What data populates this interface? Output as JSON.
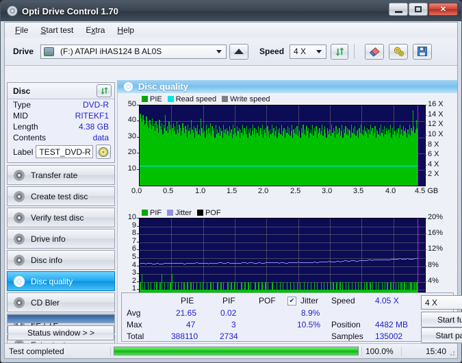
{
  "window": {
    "title": "Opti Drive Control 1.70",
    "icon": "disc-icon",
    "controls": {
      "minimize": "minimize-icon",
      "maximize": "maximize-icon",
      "close": "✕"
    }
  },
  "menu": [
    {
      "label": "File",
      "accel": "F"
    },
    {
      "label": "Start test",
      "accel": "S"
    },
    {
      "label": "Extra",
      "accel": "x"
    },
    {
      "label": "Help",
      "accel": "H"
    }
  ],
  "toolbar": {
    "drive_label": "Drive",
    "drive_value": "(F:)  ATAPI iHAS124   B AL0S",
    "eject_icon": "eject-icon",
    "speed_label": "Speed",
    "speed_value": "4 X",
    "refresh_icon": "refresh-icon",
    "erase_icon": "eraser-icon",
    "settings_icon": "gear-icon",
    "save_icon": "save-icon"
  },
  "disc": {
    "title": "Disc",
    "refresh_icon": "refresh-icon",
    "rows": [
      {
        "key": "Type",
        "value": "DVD-R"
      },
      {
        "key": "MID",
        "value": "RITEKF1"
      },
      {
        "key": "Length",
        "value": "4.38 GB"
      },
      {
        "key": "Contents",
        "value": "data"
      }
    ],
    "label_key": "Label",
    "label_value": "TEST_DVD-R",
    "label_placeholder": "",
    "disc_icon": "cd-icon"
  },
  "sidebar": {
    "items": [
      {
        "label": "Transfer rate",
        "icon": "disc-icon",
        "active": false
      },
      {
        "label": "Create test disc",
        "icon": "disc-icon",
        "active": false
      },
      {
        "label": "Verify test disc",
        "icon": "disc-icon",
        "active": false
      },
      {
        "label": "Drive info",
        "icon": "drive-icon",
        "active": false
      },
      {
        "label": "Disc info",
        "icon": "disc-icon",
        "active": false
      },
      {
        "label": "Disc quality",
        "icon": "disc-icon",
        "active": true
      },
      {
        "label": "CD Bler",
        "icon": "disc-icon",
        "active": false
      },
      {
        "label": "FE / TE",
        "icon": "disc-icon",
        "active": false
      },
      {
        "label": "Extra tests",
        "icon": "disc-icon",
        "active": false
      }
    ],
    "status_window_button": "Status window > >"
  },
  "panel": {
    "title": "Disc quality",
    "icon": "disc-icon"
  },
  "stats": {
    "col_headers": [
      "PIE",
      "PIF",
      "POF",
      "Jitter"
    ],
    "row_headers": [
      "Avg",
      "Max",
      "Total"
    ],
    "pie": {
      "avg": "21.65",
      "max": "47",
      "total": "388110"
    },
    "pif": {
      "avg": "0.02",
      "max": "3",
      "total": "2734"
    },
    "pof": {
      "avg": "",
      "max": "",
      "total": ""
    },
    "jitter": {
      "avg": "8.9%",
      "max": "10.5%",
      "total": ""
    },
    "jitter_checked": "✔",
    "speed_key": "Speed",
    "speed_value": "4.05 X",
    "position_key": "Position",
    "position_value": "4482 MB",
    "samples_key": "Samples",
    "samples_value": "135002",
    "speed_select": "4 X",
    "start_full": "Start full",
    "start_part": "Start part"
  },
  "statusbar": {
    "message": "Test completed",
    "progress_pct": "100.0%",
    "progress_value": 100,
    "time": "15:40"
  },
  "colors": {
    "pie": "#00c000",
    "read_speed": "#00e5e5",
    "write_speed": "#808080",
    "pif": "#00c000",
    "jitter": "#8f8fe8",
    "pof": "#000000",
    "plot_bg": "#0b0b56",
    "accent": "#2222cc"
  },
  "chart_data": [
    {
      "type": "bar",
      "title": "PIE",
      "xlabel": "GB",
      "ylabel": "PIE",
      "y2label": "X",
      "xlim": [
        0.0,
        4.5
      ],
      "ylim": [
        0,
        50
      ],
      "y2lim": [
        0,
        16
      ],
      "xticks": [
        "0.0",
        "0.5",
        "1.0",
        "1.5",
        "2.0",
        "2.5",
        "3.0",
        "3.5",
        "4.0",
        "4.5 GB"
      ],
      "yticks": [
        "10",
        "20",
        "30",
        "40",
        "50"
      ],
      "y2ticks": [
        "2 X",
        "4 X",
        "6 X",
        "8 X",
        "10 X",
        "12 X",
        "14 X",
        "16 X"
      ],
      "grid": true,
      "legend": [
        "PIE",
        "Read speed",
        "Write speed"
      ],
      "legend_position": "top-left",
      "data_end_x": 4.38,
      "series": [
        {
          "name": "PIE",
          "color": "#00c000",
          "values": [
            45,
            42,
            40,
            44,
            41,
            38,
            39,
            43,
            37,
            40,
            36,
            41,
            38,
            35,
            42,
            37,
            39,
            34,
            40,
            36,
            38,
            33,
            41,
            37,
            35,
            39,
            32,
            38,
            36,
            44,
            34,
            37,
            33,
            40,
            35,
            38,
            31,
            36,
            39,
            34,
            37,
            32,
            40,
            35,
            33,
            38,
            36,
            31,
            34,
            39,
            36,
            33,
            37,
            35,
            30,
            38,
            34,
            36,
            32,
            41,
            35,
            33,
            37,
            30,
            36,
            34,
            38,
            32,
            35,
            31,
            42,
            36,
            33,
            37,
            34,
            30,
            38,
            35,
            32,
            36,
            33,
            39,
            31,
            37,
            34,
            36,
            30,
            38,
            32,
            35,
            33,
            37,
            31,
            36,
            34,
            30,
            38,
            33,
            35,
            32,
            36,
            34,
            31,
            37,
            33,
            35,
            30,
            38,
            32,
            36,
            33,
            31,
            37,
            34,
            36,
            30,
            35,
            33,
            38,
            31,
            36,
            34,
            32,
            37,
            30,
            35,
            33,
            36,
            31,
            34,
            38,
            32,
            36,
            30,
            35,
            33,
            37,
            31,
            34,
            36,
            32,
            38,
            30,
            35,
            33,
            36,
            31,
            37,
            34,
            30,
            35,
            32,
            38,
            33,
            36,
            31,
            34,
            37,
            30,
            35,
            33,
            36,
            32,
            38,
            31,
            34,
            36,
            30,
            35,
            33,
            37,
            32,
            36,
            31,
            34,
            38,
            30,
            35,
            33,
            36,
            32,
            37,
            31,
            35,
            34,
            30,
            36,
            33,
            38,
            32,
            35,
            31,
            37,
            34,
            36,
            30,
            33,
            35,
            32,
            38,
            31,
            36,
            34,
            37,
            30,
            35,
            33,
            36,
            32,
            34,
            38,
            31,
            35,
            37,
            33,
            30,
            36,
            34,
            32,
            35,
            31,
            38,
            33,
            36,
            34,
            30,
            37,
            32,
            35,
            33,
            36,
            31,
            34,
            38,
            30,
            35,
            33,
            37,
            32,
            36,
            31,
            35,
            34,
            30,
            38,
            33,
            36,
            32,
            37,
            31,
            34,
            35,
            30,
            36,
            33,
            38,
            32,
            35,
            31,
            37,
            34,
            33,
            36,
            30,
            35,
            32,
            38,
            34,
            36,
            31,
            33,
            37,
            30,
            35,
            34,
            32,
            36,
            31,
            38,
            33,
            35,
            30,
            37,
            32,
            36,
            34,
            31,
            35,
            33,
            38,
            30,
            36,
            32,
            37,
            34,
            31,
            35,
            33,
            36,
            30,
            38,
            32,
            35,
            31,
            37,
            34,
            36,
            33,
            30,
            35,
            32,
            38,
            31,
            36,
            34,
            47,
            37,
            33,
            35,
            41,
            36
          ]
        },
        {
          "name": "Read speed",
          "color": "#00e5e5",
          "type": "line",
          "axis": "y2",
          "constant_value": 4.0,
          "note": "flat read speed line at about 4X"
        }
      ]
    },
    {
      "type": "bar",
      "title": "PIF",
      "xlabel": "GB",
      "ylabel": "PIF",
      "y2label": "%",
      "xlim": [
        0.0,
        4.5
      ],
      "ylim": [
        0,
        10
      ],
      "y2lim": [
        0,
        20
      ],
      "xticks": [
        "0.0",
        "0.5",
        "1.0",
        "1.5",
        "2.0",
        "2.5",
        "3.0",
        "3.5",
        "4.0",
        "4.5 GB"
      ],
      "yticks": [
        "1",
        "2",
        "3",
        "4",
        "5",
        "6",
        "7",
        "8",
        "9",
        "10"
      ],
      "y2ticks": [
        "4%",
        "8%",
        "12%",
        "16%",
        "20%"
      ],
      "grid": true,
      "legend": [
        "PIF",
        "Jitter",
        "POF"
      ],
      "legend_position": "top-left",
      "data_end_x": 4.38,
      "series": [
        {
          "name": "PIF",
          "color": "#00c000",
          "max_value": 3,
          "typical_value": 1,
          "values": [
            2,
            1,
            3,
            1,
            1,
            2,
            1,
            1,
            1,
            2,
            1,
            1,
            2,
            1,
            1,
            1,
            2,
            1,
            1,
            2,
            1,
            1,
            1,
            2,
            1,
            3,
            1,
            1,
            2,
            1,
            1,
            1,
            2,
            1,
            1,
            2,
            1,
            3,
            1,
            1,
            1,
            2,
            1,
            1,
            2,
            1,
            1,
            1,
            2,
            1,
            1,
            2,
            1,
            1,
            1,
            2,
            1,
            1,
            1,
            2,
            1,
            1,
            2,
            1,
            1,
            1,
            2,
            1,
            1,
            1,
            2,
            1,
            1,
            2,
            1,
            1,
            1,
            1,
            2,
            1,
            1,
            1,
            2,
            1,
            1,
            2,
            1,
            1,
            1,
            1,
            2,
            1,
            1,
            1,
            2,
            1,
            1,
            2,
            1,
            1,
            1,
            1,
            2,
            1,
            1,
            1,
            2,
            1,
            1,
            1,
            2,
            1,
            1,
            2,
            1,
            1,
            1,
            1,
            2,
            1,
            1,
            1,
            2,
            1,
            1,
            1,
            2,
            1,
            1,
            2,
            1,
            1,
            1,
            1,
            2,
            1,
            1,
            1,
            2,
            1,
            1,
            1,
            2,
            1,
            1,
            1,
            2,
            1,
            1,
            2,
            1,
            1,
            1,
            1,
            2,
            1,
            1,
            1,
            1,
            2,
            1,
            1,
            1,
            2,
            1,
            1,
            2,
            1,
            1,
            1,
            1,
            2,
            1,
            1,
            1,
            2,
            1,
            1,
            1,
            2,
            1,
            1,
            1,
            2,
            1,
            1,
            2,
            1,
            1,
            1,
            1,
            2,
            1,
            1,
            1,
            2,
            1,
            1,
            1,
            2,
            1,
            1,
            1,
            2,
            1,
            1,
            2,
            1,
            1,
            1,
            1,
            2,
            1,
            1,
            2,
            1,
            1,
            1,
            2,
            1,
            1,
            1,
            2,
            1,
            1,
            2,
            1,
            1,
            1,
            2,
            1,
            1,
            1,
            2,
            1,
            1,
            2,
            1,
            1,
            1,
            2,
            1,
            1,
            2,
            1,
            1,
            1,
            2,
            1,
            1,
            1,
            2,
            1,
            1,
            2,
            1,
            1,
            2,
            1,
            1,
            1,
            2,
            1,
            1,
            2,
            1,
            1,
            1,
            2,
            1,
            1,
            2,
            1,
            1,
            1,
            2,
            1,
            1,
            2,
            1,
            1,
            1,
            2,
            1,
            1,
            2,
            1,
            1,
            2,
            1,
            1,
            1,
            2,
            1,
            1,
            2,
            1,
            1,
            2,
            1,
            1,
            2,
            1,
            1,
            2,
            1,
            2,
            1,
            2,
            1,
            1,
            2,
            1,
            2,
            1,
            2,
            2,
            1,
            2,
            1,
            2,
            1,
            2,
            2
          ]
        },
        {
          "name": "Jitter",
          "color": "#8f8fe8",
          "type": "line",
          "axis": "y2",
          "start_value": 8.7,
          "end_value": 10.0,
          "avg_value": 8.9,
          "max_value": 10.5,
          "note": "slowly rising jitter line from about 8.5% to 10%"
        },
        {
          "name": "POF",
          "color": "#000000",
          "values": []
        }
      ]
    }
  ]
}
